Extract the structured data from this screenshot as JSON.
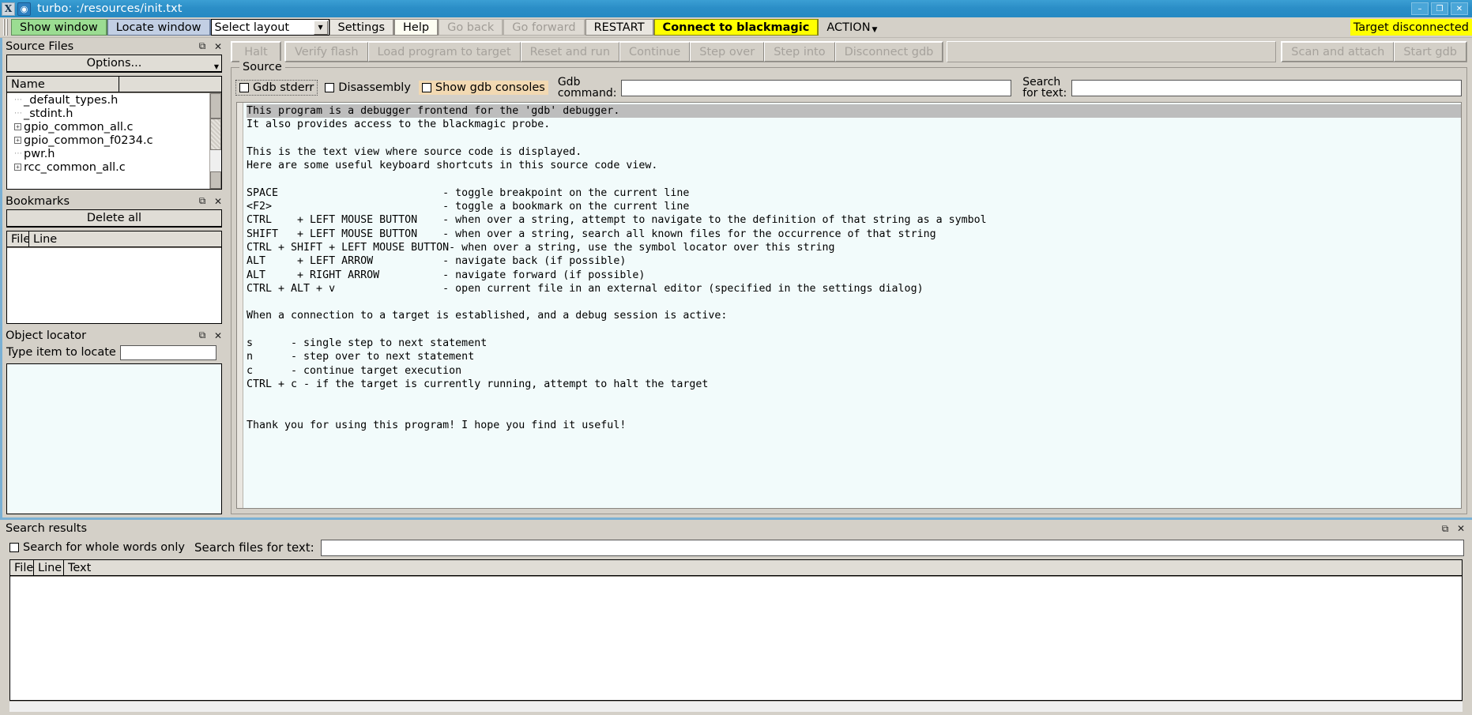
{
  "window": {
    "title": "turbo: :/resources/init.txt",
    "app_icon": "x-window-icon",
    "doc_icon": "disc-icon",
    "controls": [
      {
        "name": "minimize-button",
        "glyph": "–"
      },
      {
        "name": "maximize-button",
        "glyph": "❐"
      },
      {
        "name": "close-button",
        "glyph": "✕"
      }
    ]
  },
  "menubar": {
    "show_window": "Show window",
    "locate_window": "Locate window",
    "layout_select": {
      "value": "Select layout",
      "placeholder": "Select layout"
    },
    "settings": "Settings",
    "help": "Help",
    "go_back": "Go back",
    "go_forward": "Go forward",
    "restart": "RESTART",
    "connect_blackmagic": "Connect to blackmagic",
    "action": "ACTION",
    "target_status": "Target disconnected",
    "colors": {
      "yellow": "#ffff00",
      "green": "#9bdd92",
      "blue": "#c2cfe4"
    }
  },
  "debugbar": {
    "halt": "Halt",
    "buttons": [
      "Verify flash",
      "Load program to target",
      "Reset and run",
      "Continue",
      "Step over",
      "Step into",
      "Disconnect gdb"
    ],
    "right_buttons": [
      "Scan and attach",
      "Start gdb"
    ]
  },
  "source_files_panel": {
    "title": "Source Files",
    "restore_icon": "restore-icon",
    "close_icon": "close-icon",
    "options_button": "Options...",
    "column_name": "Name",
    "files": [
      {
        "label": "_default_types.h",
        "expandable": false
      },
      {
        "label": "_stdint.h",
        "expandable": false
      },
      {
        "label": "gpio_common_all.c",
        "expandable": true
      },
      {
        "label": "gpio_common_f0234.c",
        "expandable": true
      },
      {
        "label": "pwr.h",
        "expandable": false
      },
      {
        "label": "rcc_common_all.c",
        "expandable": true
      }
    ]
  },
  "bookmarks_panel": {
    "title": "Bookmarks",
    "delete_all": "Delete all",
    "columns": [
      "File",
      "Line"
    ],
    "rows": []
  },
  "object_locator_panel": {
    "title": "Object locator",
    "label": "Type item to locate",
    "input_value": "",
    "input_placeholder": ""
  },
  "source_group": {
    "legend": "Source",
    "checkboxes": [
      {
        "label": "Gdb stderr",
        "checked": false,
        "focused": true,
        "highlight": false
      },
      {
        "label": "Disassembly",
        "checked": false,
        "focused": false,
        "highlight": false
      },
      {
        "label": "Show gdb consoles",
        "checked": false,
        "focused": false,
        "highlight": true
      }
    ],
    "gdb_command_label_l1": "Gdb",
    "gdb_command_label_l2": "command:",
    "gdb_command_value": "",
    "search_label_l1": "Search",
    "search_label_l2": "for text:",
    "search_value": "",
    "code_lines": [
      {
        "text": "This program is a debugger frontend for the 'gdb' debugger.",
        "selected": true
      },
      {
        "text": "It also provides access to the blackmagic probe.",
        "selected": false
      },
      {
        "text": "",
        "selected": false
      },
      {
        "text": "This is the text view where source code is displayed.",
        "selected": false
      },
      {
        "text": "Here are some useful keyboard shortcuts in this source code view.",
        "selected": false
      },
      {
        "text": "",
        "selected": false
      },
      {
        "text": "SPACE                          - toggle breakpoint on the current line",
        "selected": false
      },
      {
        "text": "<F2>                           - toggle a bookmark on the current line",
        "selected": false
      },
      {
        "text": "CTRL    + LEFT MOUSE BUTTON    - when over a string, attempt to navigate to the definition of that string as a symbol",
        "selected": false
      },
      {
        "text": "SHIFT   + LEFT MOUSE BUTTON    - when over a string, search all known files for the occurrence of that string",
        "selected": false
      },
      {
        "text": "CTRL + SHIFT + LEFT MOUSE BUTTON- when over a string, use the symbol locator over this string",
        "selected": false
      },
      {
        "text": "ALT     + LEFT ARROW           - navigate back (if possible)",
        "selected": false
      },
      {
        "text": "ALT     + RIGHT ARROW          - navigate forward (if possible)",
        "selected": false
      },
      {
        "text": "CTRL + ALT + v                 - open current file in an external editor (specified in the settings dialog)",
        "selected": false
      },
      {
        "text": "",
        "selected": false
      },
      {
        "text": "When a connection to a target is established, and a debug session is active:",
        "selected": false
      },
      {
        "text": "",
        "selected": false
      },
      {
        "text": "s      - single step to next statement",
        "selected": false
      },
      {
        "text": "n      - step over to next statement",
        "selected": false
      },
      {
        "text": "c      - continue target execution",
        "selected": false
      },
      {
        "text": "CTRL + c - if the target is currently running, attempt to halt the target",
        "selected": false
      },
      {
        "text": "",
        "selected": false
      },
      {
        "text": "",
        "selected": false
      },
      {
        "text": "Thank you for using this program! I hope you find it useful!",
        "selected": false
      }
    ]
  },
  "search_results_panel": {
    "title": "Search results",
    "restore_icon": "restore-icon",
    "close_icon": "close-icon",
    "whole_words_label": "Search for whole words only",
    "whole_words_checked": false,
    "search_files_label": "Search files for text:",
    "search_files_value": "",
    "columns": [
      "File",
      "Line",
      "Text"
    ],
    "rows": []
  }
}
